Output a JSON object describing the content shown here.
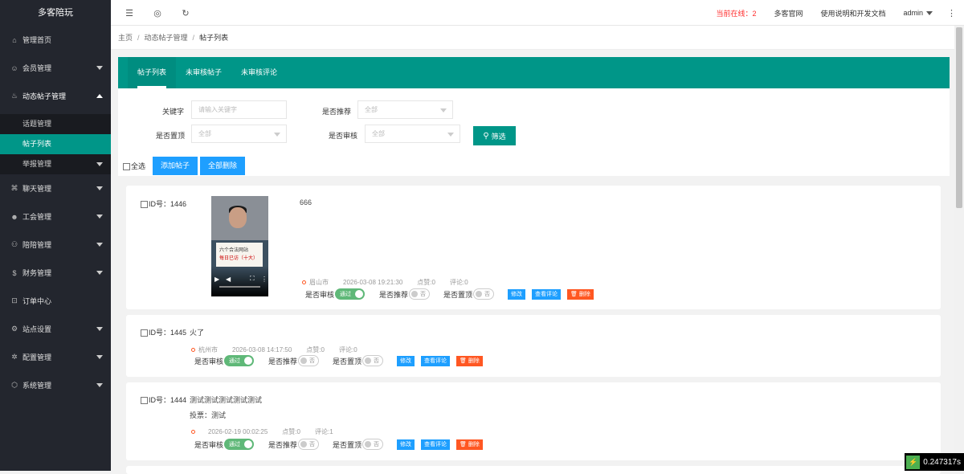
{
  "app": {
    "title": "多客陪玩"
  },
  "sidebar": {
    "items": [
      {
        "label": "管理首页",
        "icon": "home-icon"
      },
      {
        "label": "会员管理",
        "icon": "user-icon"
      },
      {
        "label": "动态帖子管理",
        "icon": "fire-icon"
      },
      {
        "label": "聊天管理",
        "icon": "chat-icon"
      },
      {
        "label": "工会管理",
        "icon": "group-icon"
      },
      {
        "label": "陪陪管理",
        "icon": "companion-icon"
      },
      {
        "label": "财务管理",
        "icon": "money-icon"
      },
      {
        "label": "订单中心",
        "icon": "cart-icon"
      },
      {
        "label": "站点设置",
        "icon": "settings-icon"
      },
      {
        "label": "配置管理",
        "icon": "config-icon"
      },
      {
        "label": "系统管理",
        "icon": "system-icon"
      }
    ],
    "submenu": [
      {
        "label": "话题管理"
      },
      {
        "label": "帖子列表"
      },
      {
        "label": "举报管理"
      }
    ]
  },
  "header": {
    "online": "当前在线：2",
    "site": "多客官网",
    "docs": "使用说明和开发文档",
    "user": "admin"
  },
  "breadcrumb": {
    "home": "主页",
    "section": "动态帖子管理",
    "current": "帖子列表"
  },
  "tabs": [
    {
      "label": "帖子列表"
    },
    {
      "label": "未审核帖子"
    },
    {
      "label": "未审核评论"
    }
  ],
  "filters": {
    "keyword_label": "关键字",
    "keyword_placeholder": "请输入关键字",
    "recommend_label": "是否推荐",
    "recommend_value": "全部",
    "top_label": "是否置顶",
    "top_value": "全部",
    "audit_label": "是否审核",
    "audit_value": "全部",
    "filter_button": "筛选"
  },
  "actions": {
    "select_all": "全选",
    "add": "添加帖子",
    "delete_all": "全部删除"
  },
  "post_labels": {
    "audit": "是否审核",
    "recommend": "是否推荐",
    "top": "是否置顶",
    "on": "通过",
    "off": "否",
    "edit": "修改",
    "view_comments": "查看评论",
    "delete": "删除"
  },
  "posts": [
    {
      "id": "ID号：1446",
      "text": "666",
      "city": "眉山市",
      "time": "2026-03-08 19:21:30",
      "likes": "点赞:0",
      "comments": "评论:0",
      "video_caption_1": "六个合法网站",
      "video_caption_2": "每日已访（十大）"
    },
    {
      "id": "ID号：1445",
      "text": "火了",
      "city": "杭州市",
      "time": "2026-03-08 14:17:50",
      "likes": "点赞:0",
      "comments": "评论:0"
    },
    {
      "id": "ID号：1444",
      "text": "测试测试测试测试测试",
      "vote": "投票：测试",
      "city": "",
      "time": "2026-02-19 00:02:25",
      "likes": "点赞:0",
      "comments": "评论:1"
    }
  ],
  "timer": "0.247317s"
}
